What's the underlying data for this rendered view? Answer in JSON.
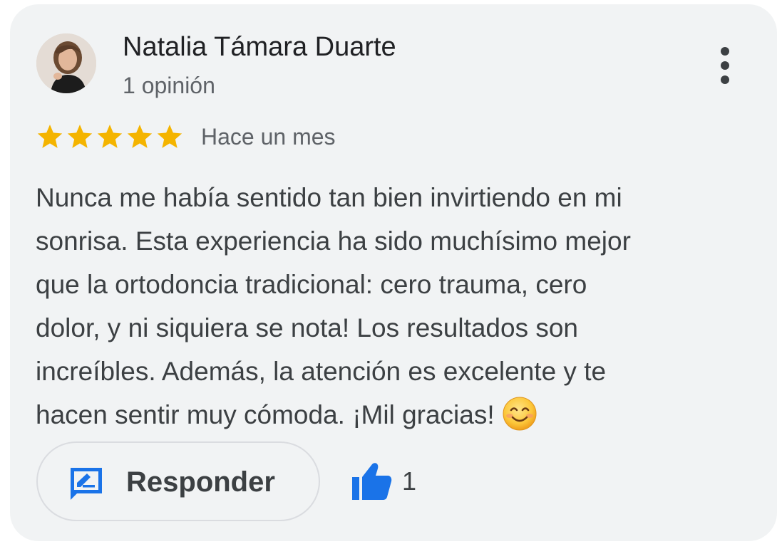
{
  "review": {
    "author_name": "Natalia Támara Duarte",
    "author_meta": "1 opinión",
    "rating": 5,
    "rating_max": 5,
    "date": "Hace un mes",
    "text_lines": [
      "Nunca me había sentido tan bien invirtiendo en mi",
      "sonrisa. Esta experiencia ha sido muchísimo mejor",
      "que la ortodoncia tradicional: cero trauma, cero",
      "dolor, y ni siquiera se nota! Los resultados son",
      "increíbles. Además, la atención es excelente y te",
      "hacen sentir muy cómoda. ¡Mil gracias!"
    ],
    "text_emoji": "smiling-face-emoji"
  },
  "actions": {
    "reply_label": "Responder",
    "like_count": "1"
  },
  "icons": {
    "more": "more-vertical-icon",
    "reply": "reply-icon",
    "like": "thumbs-up-icon",
    "star": "star-icon"
  },
  "colors": {
    "card_background": "#f1f3f4",
    "star": "#f4b400",
    "accent_blue": "#1a73e8",
    "text_primary": "#202124",
    "text_secondary": "#5f6368"
  }
}
